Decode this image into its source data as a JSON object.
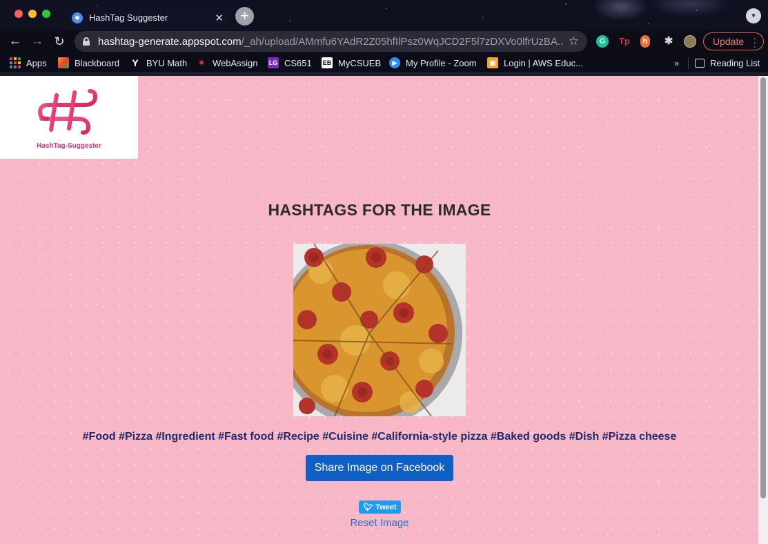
{
  "browser": {
    "tab_title": "HashTag Suggester",
    "url_host": "hashtag-generate.appspot.com",
    "url_path": "/_ah/upload/AMmfu6YAdR2Z05hfIlPsz0WqJCD2F5l7zDXVo0lfrUzBA...",
    "update_label": "Update",
    "bookmarks": [
      {
        "label": "Apps",
        "icon": "apps-grid-icon"
      },
      {
        "label": "Blackboard",
        "icon": "blackboard-icon"
      },
      {
        "label": "BYU Math",
        "icon": "byu-icon"
      },
      {
        "label": "WebAssign",
        "icon": "webassign-icon"
      },
      {
        "label": "CS651",
        "icon": "cs651-icon"
      },
      {
        "label": "MyCSUEB",
        "icon": "mycsueb-icon"
      },
      {
        "label": "My Profile - Zoom",
        "icon": "zoom-icon"
      },
      {
        "label": "Login | AWS Educ...",
        "icon": "aws-icon"
      }
    ],
    "more_bookmarks": "»",
    "reading_list": "Reading List"
  },
  "page": {
    "logo_text": "HashTag-Suggester",
    "heading": "HASHTAGS FOR THE IMAGE",
    "hashtags": "#Food #Pizza #Ingredient #Fast food #Recipe #Cuisine #California-style pizza #Baked goods #Dish #Pizza cheese",
    "facebook_button": "Share Image on Facebook",
    "tweet_button": "Tweet",
    "reset_link": "Reset Image"
  },
  "colors": {
    "page_background": "#f7b7c6",
    "facebook_blue": "#0f5fc7",
    "twitter_blue": "#1d9bf0",
    "logo_pink": "#e0316d",
    "hashtag_text": "#1f2a6b"
  }
}
